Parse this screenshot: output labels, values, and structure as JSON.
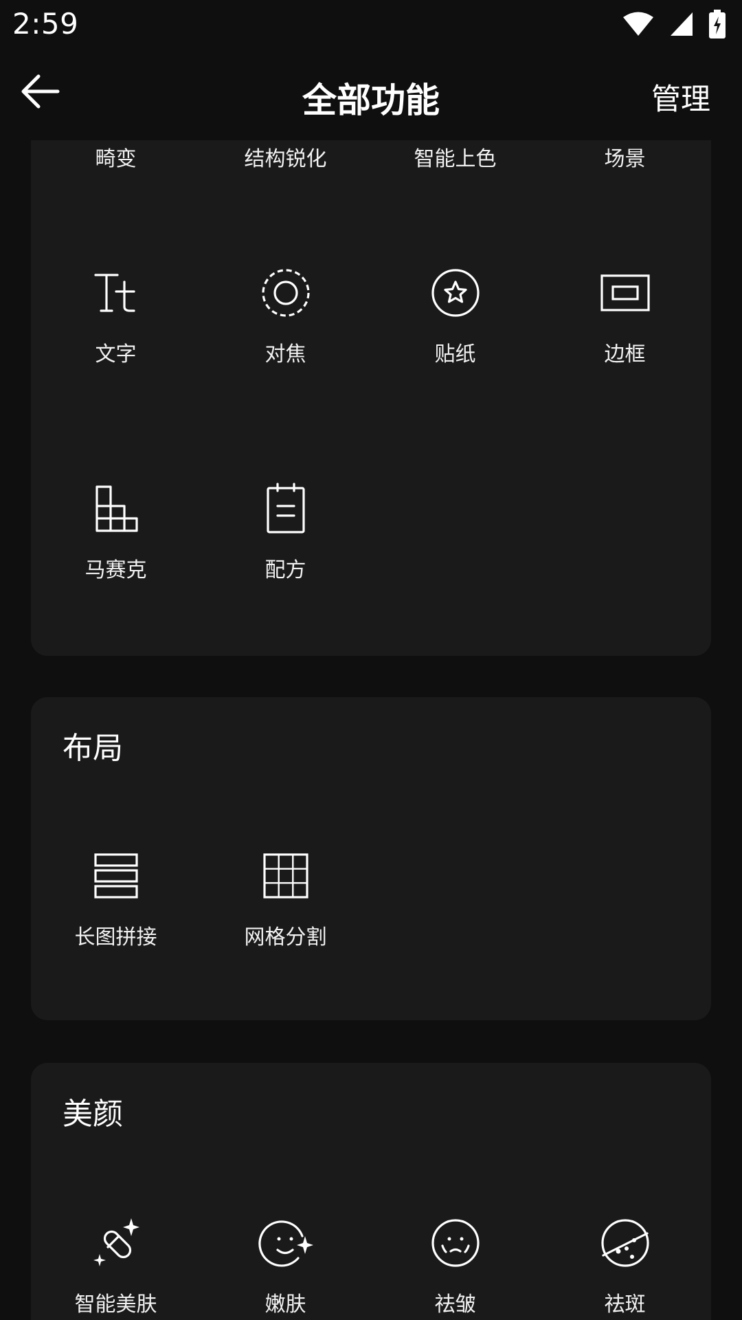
{
  "status": {
    "time": "2:59",
    "icons": [
      "wifi-icon",
      "cellular-signal-icon",
      "battery-charging-icon"
    ]
  },
  "header": {
    "title": "全部功能",
    "manage_label": "管理",
    "back_icon": "back-arrow-icon"
  },
  "sections": {
    "editing": {
      "top_labels": [
        "畸变",
        "结构锐化",
        "智能上色",
        "场景"
      ],
      "items": [
        {
          "label": "文字",
          "icon": "text-icon"
        },
        {
          "label": "对焦",
          "icon": "focus-icon"
        },
        {
          "label": "贴纸",
          "icon": "sticker-icon"
        },
        {
          "label": "边框",
          "icon": "frame-icon"
        },
        {
          "label": "马赛克",
          "icon": "mosaic-icon"
        },
        {
          "label": "配方",
          "icon": "recipe-icon"
        }
      ]
    },
    "layout": {
      "title": "布局",
      "items": [
        {
          "label": "长图拼接",
          "icon": "long-image-stitch-icon"
        },
        {
          "label": "网格分割",
          "icon": "grid-split-icon"
        }
      ]
    },
    "beauty": {
      "title": "美颜",
      "items": [
        {
          "label": "智能美肤",
          "icon": "smart-skin-icon"
        },
        {
          "label": "嫩肤",
          "icon": "skin-smooth-icon"
        },
        {
          "label": "祛皱",
          "icon": "wrinkle-removal-icon"
        },
        {
          "label": "祛斑",
          "icon": "spot-removal-icon"
        }
      ]
    }
  },
  "colors": {
    "background": "#0f0f0f",
    "card": "#1a1a1a",
    "text": "#ffffff"
  }
}
